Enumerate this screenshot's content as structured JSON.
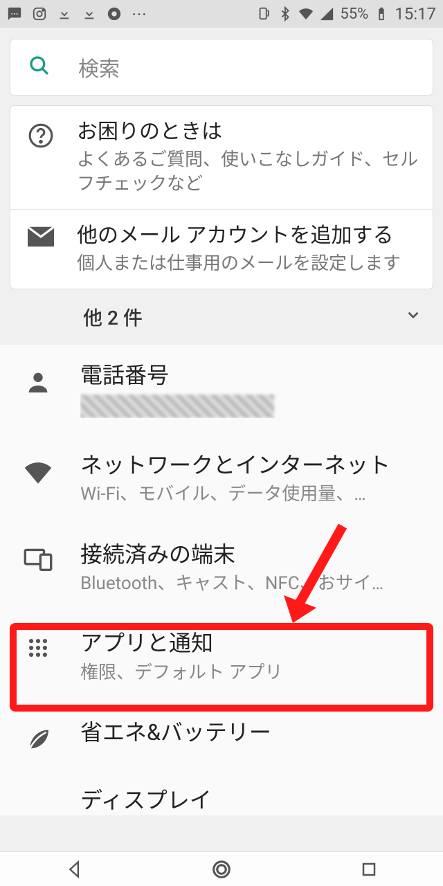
{
  "status": {
    "battery_pct": "55%",
    "time": "15:17"
  },
  "search": {
    "placeholder": "検索"
  },
  "suggestions": [
    {
      "title": "お困りのときは",
      "sub": "よくあるご質問、使いこなしガイド、セルフチェックなど"
    },
    {
      "title": "他のメール アカウントを追加する",
      "sub": "個人または仕事用のメールを設定します"
    }
  ],
  "expand_label": "他 2 件",
  "settings": [
    {
      "title": "電話番号",
      "sub": ""
    },
    {
      "title": "ネットワークとインターネット",
      "sub": "Wi-Fi、モバイル、データ使用量、…"
    },
    {
      "title": "接続済みの端末",
      "sub": "Bluetooth、キャスト、NFC、おサイ…"
    },
    {
      "title": "アプリと通知",
      "sub": "権限、デフォルト アプリ"
    },
    {
      "title": "省エネ&バッテリー",
      "sub": ""
    },
    {
      "title": "ディスプレイ",
      "sub": ""
    }
  ]
}
